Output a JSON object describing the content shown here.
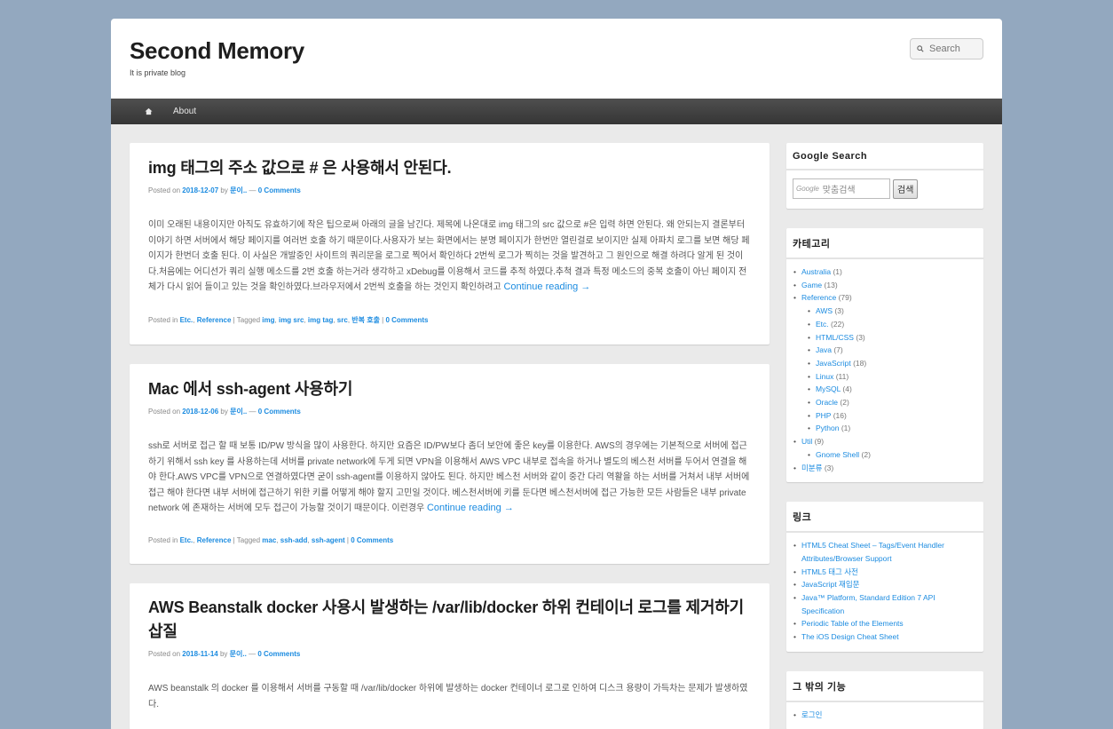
{
  "site": {
    "title": "Second Memory",
    "description": "It is private blog",
    "search_placeholder": "Search"
  },
  "nav": {
    "about": "About"
  },
  "posts": [
    {
      "title": "img 태그의 주소 값으로 # 은 사용해서 안된다.",
      "posted_on": "Posted on",
      "date": "2018-12-07",
      "by": "by",
      "author": "문이..",
      "sep": "—",
      "comments": "0 Comments",
      "excerpt": "이미 오래된 내용이지만 아직도 유효하기에 작은 팁으로써 아래의 글을 남긴다. 제목에 나온대로 img 태그의 src 값으로 #은 입력 하면 안된다. 왜 안되는지 결론부터 이야기 하면 서버에서 해당 페이지를 여러번 호출 하기 때문이다.사용자가 보는 화면에서는 분명 페이지가 한번만 열린걸로 보이지만 실제 아파치 로그를 보면 해당 페이지가 한번더 호출 된다. 이 사실은 개발중인 사이트의 쿼리문을 로그로 찍어서 확인하다 2번씩 로그가 찍히는 것을 발견하고 그 원인으로 해결 하려다 알게 된 것이다.처음에는 어디선가 쿼리 실행 메소드를 2번 호출 하는거라 생각하고 xDebug를 이용해서 코드를 추적 하였다.추척 결과 특정 메소드의 중복 호출이 아닌 페이지 전체가 다시 읽어 들이고 있는 것을 확인하였다.브라우저에서 2번씩 호출을 하는 것인지 확인하려고",
      "continue": "Continue reading →",
      "posted_in": "Posted in",
      "categories": [
        "Etc.",
        "Reference"
      ],
      "tagged": "Tagged",
      "tags": [
        "img",
        "img src",
        "img tag",
        "src",
        "반복 호출"
      ]
    },
    {
      "title": "Mac 에서 ssh-agent 사용하기",
      "posted_on": "Posted on",
      "date": "2018-12-06",
      "by": "by",
      "author": "문이..",
      "sep": "—",
      "comments": "0 Comments",
      "excerpt": "ssh로 서버로 접근 할 때 보통 ID/PW 방식을 많이 사용한다. 하지만 요즘은 ID/PW보다 좀더 보안에 좋은 key를 이용한다. AWS의 경우에는 기본적으로 서버에 접근하기 위해서 ssh key 를 사용하는데 서버를 private network에 두게 되면 VPN을 이용해서 AWS VPC 내부로 접속을 하거나 별도의 베스천 서버를 두어서 연결을 해야 한다.AWS VPC를 VPN으로 연결하였다면 굳이 ssh-agent를 이용하지 않아도 된다. 하지만 베스천 서버와 같이 중간 다리 역활을 하는 서버를 거쳐서 내부 서버에 접근 해야 한다면 내부 서버에 접근하기 위한 키를 어떻게 해야 할지 고민일 것이다. 베스천서버에 키를 둔다면 베스천서버에 접근 가능한 모든 사람들은 내부 private network 에 존재하는 서버에 모두 접근이 가능할 것이기 때문이다. 이런경우",
      "continue": "Continue reading →",
      "posted_in": "Posted in",
      "categories": [
        "Etc.",
        "Reference"
      ],
      "tagged": "Tagged",
      "tags": [
        "mac",
        "ssh-add",
        "ssh-agent"
      ]
    },
    {
      "title": "AWS Beanstalk docker 사용시 발생하는 /var/lib/docker 하위 컨테이너 로그를 제거하기 삽질",
      "posted_on": "Posted on",
      "date": "2018-11-14",
      "by": "by",
      "author": "문이..",
      "sep": "—",
      "comments": "0 Comments",
      "excerpt": "AWS beanstalk 의 docker 를 이용해서 서버를 구동할 때 /var/lib/docker 하위에 발생하는 docker 컨테이너 로그로 인하여 디스크 용량이 가득차는 문제가 발생하였다."
    }
  ],
  "sidebar": {
    "google": {
      "title": "Google Search",
      "logo": "Google",
      "placeholder": "맞춤검색",
      "button": "검색"
    },
    "categories": {
      "title": "카테고리",
      "items": [
        {
          "name": "Australia",
          "count": "(1)"
        },
        {
          "name": "Game",
          "count": "(13)"
        },
        {
          "name": "Reference",
          "count": "(79)",
          "children": [
            {
              "name": "AWS",
              "count": "(3)"
            },
            {
              "name": "Etc.",
              "count": "(22)"
            },
            {
              "name": "HTML/CSS",
              "count": "(3)"
            },
            {
              "name": "Java",
              "count": "(7)"
            },
            {
              "name": "JavaScript",
              "count": "(18)"
            },
            {
              "name": "Linux",
              "count": "(11)"
            },
            {
              "name": "MySQL",
              "count": "(4)"
            },
            {
              "name": "Oracle",
              "count": "(2)"
            },
            {
              "name": "PHP",
              "count": "(16)"
            },
            {
              "name": "Python",
              "count": "(1)"
            }
          ]
        },
        {
          "name": "Util",
          "count": "(9)",
          "children": [
            {
              "name": "Gnome Shell",
              "count": "(2)"
            }
          ]
        },
        {
          "name": "미분류",
          "count": "(3)"
        }
      ]
    },
    "links": {
      "title": "링크",
      "items": [
        "HTML5 Cheat Sheet – Tags/Event Handler Attributes/Browser Support",
        "HTML5 태그 사전",
        "JavaScript 재입문",
        "Java™ Platform, Standard Edition 7 API Specification",
        "Periodic Table of the Elements",
        "The iOS Design Cheat Sheet"
      ]
    },
    "other": {
      "title": "그 밖의 기능",
      "items": [
        "로그인"
      ]
    }
  }
}
